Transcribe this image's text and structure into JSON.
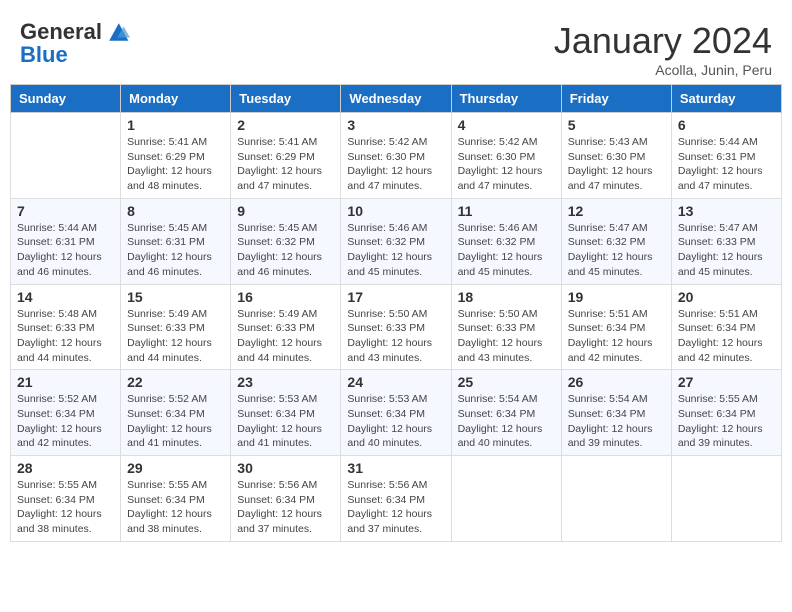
{
  "header": {
    "logo_general": "General",
    "logo_blue": "Blue",
    "month_title": "January 2024",
    "subtitle": "Acolla, Junin, Peru"
  },
  "days_of_week": [
    "Sunday",
    "Monday",
    "Tuesday",
    "Wednesday",
    "Thursday",
    "Friday",
    "Saturday"
  ],
  "weeks": [
    [
      {
        "day": "",
        "sunrise": "",
        "sunset": "",
        "daylight": ""
      },
      {
        "day": "1",
        "sunrise": "5:41 AM",
        "sunset": "6:29 PM",
        "daylight": "12 hours and 48 minutes."
      },
      {
        "day": "2",
        "sunrise": "5:41 AM",
        "sunset": "6:29 PM",
        "daylight": "12 hours and 47 minutes."
      },
      {
        "day": "3",
        "sunrise": "5:42 AM",
        "sunset": "6:30 PM",
        "daylight": "12 hours and 47 minutes."
      },
      {
        "day": "4",
        "sunrise": "5:42 AM",
        "sunset": "6:30 PM",
        "daylight": "12 hours and 47 minutes."
      },
      {
        "day": "5",
        "sunrise": "5:43 AM",
        "sunset": "6:30 PM",
        "daylight": "12 hours and 47 minutes."
      },
      {
        "day": "6",
        "sunrise": "5:44 AM",
        "sunset": "6:31 PM",
        "daylight": "12 hours and 47 minutes."
      }
    ],
    [
      {
        "day": "7",
        "sunrise": "5:44 AM",
        "sunset": "6:31 PM",
        "daylight": "12 hours and 46 minutes."
      },
      {
        "day": "8",
        "sunrise": "5:45 AM",
        "sunset": "6:31 PM",
        "daylight": "12 hours and 46 minutes."
      },
      {
        "day": "9",
        "sunrise": "5:45 AM",
        "sunset": "6:32 PM",
        "daylight": "12 hours and 46 minutes."
      },
      {
        "day": "10",
        "sunrise": "5:46 AM",
        "sunset": "6:32 PM",
        "daylight": "12 hours and 45 minutes."
      },
      {
        "day": "11",
        "sunrise": "5:46 AM",
        "sunset": "6:32 PM",
        "daylight": "12 hours and 45 minutes."
      },
      {
        "day": "12",
        "sunrise": "5:47 AM",
        "sunset": "6:32 PM",
        "daylight": "12 hours and 45 minutes."
      },
      {
        "day": "13",
        "sunrise": "5:47 AM",
        "sunset": "6:33 PM",
        "daylight": "12 hours and 45 minutes."
      }
    ],
    [
      {
        "day": "14",
        "sunrise": "5:48 AM",
        "sunset": "6:33 PM",
        "daylight": "12 hours and 44 minutes."
      },
      {
        "day": "15",
        "sunrise": "5:49 AM",
        "sunset": "6:33 PM",
        "daylight": "12 hours and 44 minutes."
      },
      {
        "day": "16",
        "sunrise": "5:49 AM",
        "sunset": "6:33 PM",
        "daylight": "12 hours and 44 minutes."
      },
      {
        "day": "17",
        "sunrise": "5:50 AM",
        "sunset": "6:33 PM",
        "daylight": "12 hours and 43 minutes."
      },
      {
        "day": "18",
        "sunrise": "5:50 AM",
        "sunset": "6:33 PM",
        "daylight": "12 hours and 43 minutes."
      },
      {
        "day": "19",
        "sunrise": "5:51 AM",
        "sunset": "6:34 PM",
        "daylight": "12 hours and 42 minutes."
      },
      {
        "day": "20",
        "sunrise": "5:51 AM",
        "sunset": "6:34 PM",
        "daylight": "12 hours and 42 minutes."
      }
    ],
    [
      {
        "day": "21",
        "sunrise": "5:52 AM",
        "sunset": "6:34 PM",
        "daylight": "12 hours and 42 minutes."
      },
      {
        "day": "22",
        "sunrise": "5:52 AM",
        "sunset": "6:34 PM",
        "daylight": "12 hours and 41 minutes."
      },
      {
        "day": "23",
        "sunrise": "5:53 AM",
        "sunset": "6:34 PM",
        "daylight": "12 hours and 41 minutes."
      },
      {
        "day": "24",
        "sunrise": "5:53 AM",
        "sunset": "6:34 PM",
        "daylight": "12 hours and 40 minutes."
      },
      {
        "day": "25",
        "sunrise": "5:54 AM",
        "sunset": "6:34 PM",
        "daylight": "12 hours and 40 minutes."
      },
      {
        "day": "26",
        "sunrise": "5:54 AM",
        "sunset": "6:34 PM",
        "daylight": "12 hours and 39 minutes."
      },
      {
        "day": "27",
        "sunrise": "5:55 AM",
        "sunset": "6:34 PM",
        "daylight": "12 hours and 39 minutes."
      }
    ],
    [
      {
        "day": "28",
        "sunrise": "5:55 AM",
        "sunset": "6:34 PM",
        "daylight": "12 hours and 38 minutes."
      },
      {
        "day": "29",
        "sunrise": "5:55 AM",
        "sunset": "6:34 PM",
        "daylight": "12 hours and 38 minutes."
      },
      {
        "day": "30",
        "sunrise": "5:56 AM",
        "sunset": "6:34 PM",
        "daylight": "12 hours and 37 minutes."
      },
      {
        "day": "31",
        "sunrise": "5:56 AM",
        "sunset": "6:34 PM",
        "daylight": "12 hours and 37 minutes."
      },
      {
        "day": "",
        "sunrise": "",
        "sunset": "",
        "daylight": ""
      },
      {
        "day": "",
        "sunrise": "",
        "sunset": "",
        "daylight": ""
      },
      {
        "day": "",
        "sunrise": "",
        "sunset": "",
        "daylight": ""
      }
    ]
  ],
  "labels": {
    "sunrise": "Sunrise:",
    "sunset": "Sunset:",
    "daylight": "Daylight:"
  }
}
